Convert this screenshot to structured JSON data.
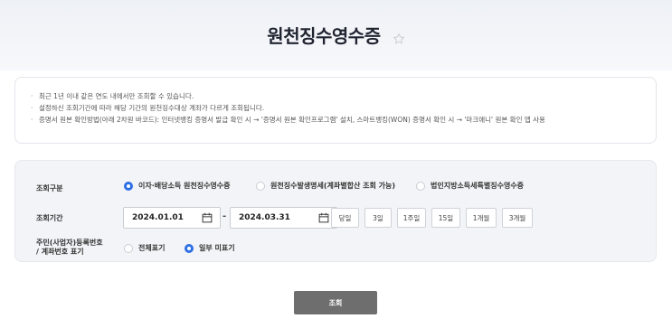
{
  "header": {
    "title": "원천징수영수증",
    "favorite_icon": "star-outline-icon"
  },
  "notice": {
    "items": [
      "최근 1년 이내 같은 연도 내에서만 조회할 수 있습니다.",
      "설정하신 조회기간에 따라 해당 기간의 원천징수대상 계좌가 다르게 조회됩니다.",
      "증명서 원본 확인방법(아래 2차원 바코드): 인터넷뱅킹 증명서 발급 확인 시 → '증명서 원본 확인프로그램' 설치, 스마트뱅킹(WON) 증명서 확인 시 → '마크애니' 원본 확인 앱 사용"
    ]
  },
  "form": {
    "type_row": {
      "label": "조회구분",
      "options": [
        {
          "label": "이자·배당소득 원천징수영수증",
          "checked": true
        },
        {
          "label": "원천징수발생명세(계좌별합산 조회 가능)",
          "checked": false
        },
        {
          "label": "법인지방소득세특별징수영수증",
          "checked": false
        }
      ]
    },
    "period_row": {
      "label": "조회기간",
      "start_date": "2024.01.01",
      "end_date": "2024.03.31",
      "separator": "-",
      "quick_buttons": [
        "당일",
        "3일",
        "1주일",
        "15일",
        "1개월",
        "3개월"
      ],
      "calendar_icon": "calendar-icon"
    },
    "mask_row": {
      "label_line1": "주민(사업자)등록번호",
      "label_line2": "/ 계좌번호 표기",
      "options": [
        {
          "label": "전체표기",
          "checked": false
        },
        {
          "label": "일부 미표기",
          "checked": true
        }
      ]
    }
  },
  "actions": {
    "search_label": "조회"
  },
  "colors": {
    "accent": "#2e6fe6",
    "search_button": "#6e6e6e",
    "panel_bg": "#f3f4f7"
  }
}
